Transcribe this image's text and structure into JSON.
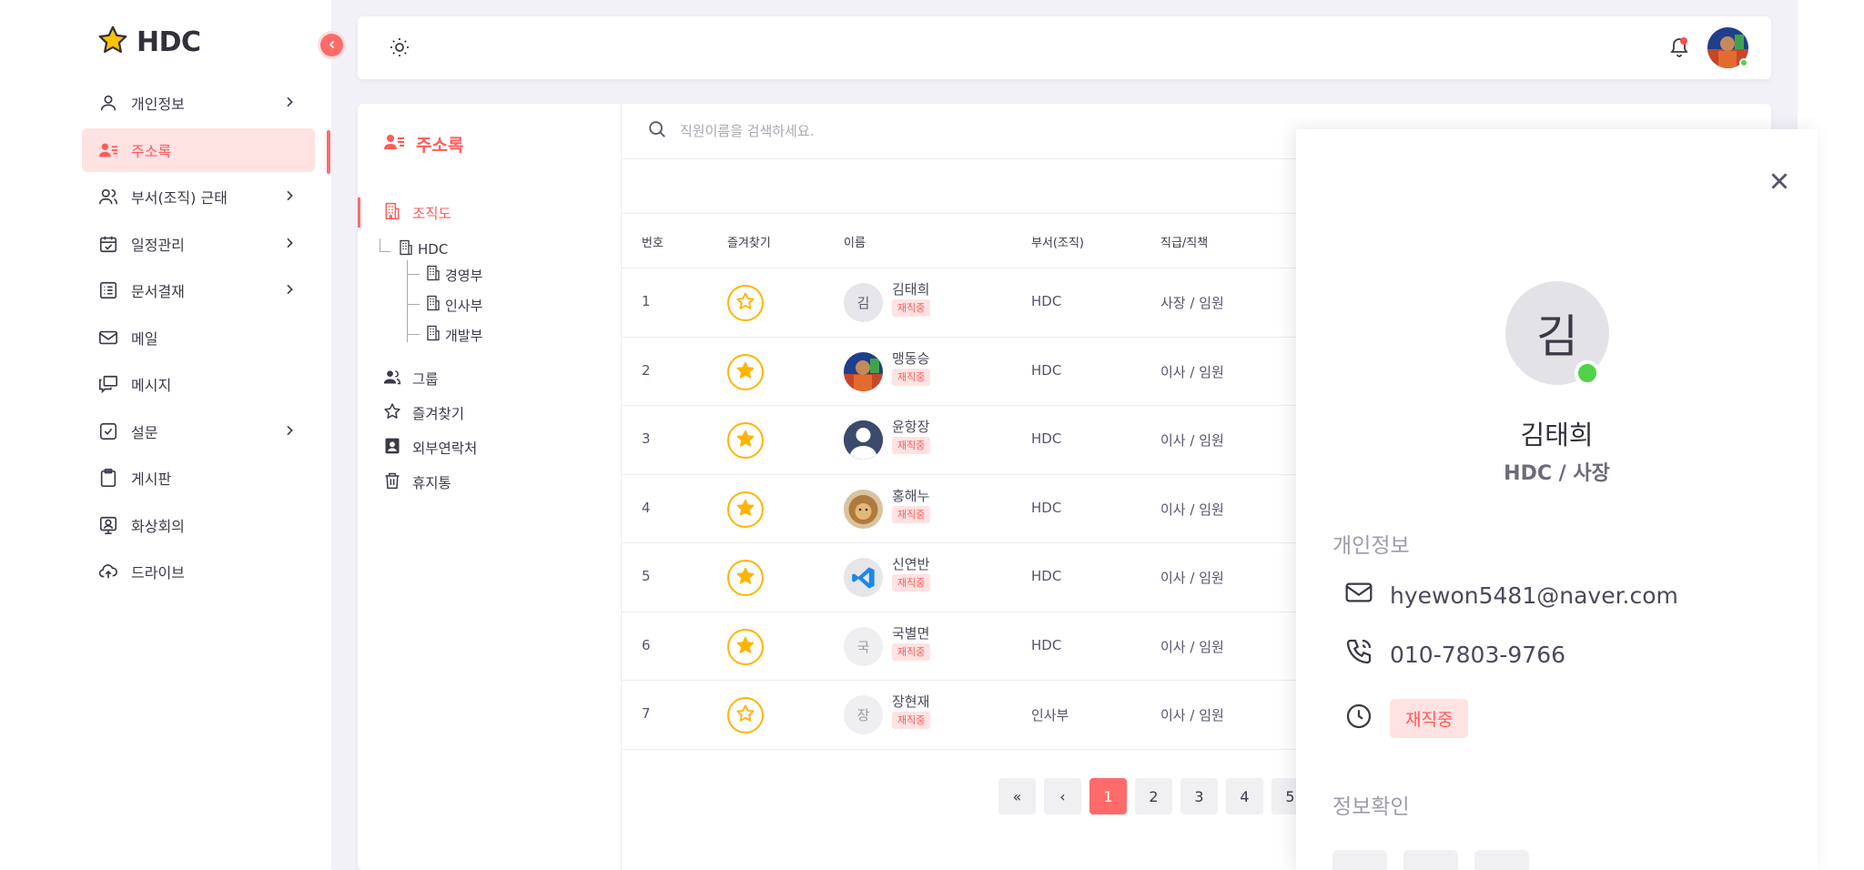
{
  "app": {
    "logo_text": "HDC",
    "accent": "#ff6b6b"
  },
  "sidebar": {
    "items": [
      {
        "label": "개인정보",
        "icon": "user-icon",
        "has_chevron": true
      },
      {
        "label": "주소록",
        "icon": "contacts-icon",
        "active": true
      },
      {
        "label": "부서(조직) 근태",
        "icon": "users-icon",
        "has_chevron": true
      },
      {
        "label": "일정관리",
        "icon": "calendar-check-icon",
        "has_chevron": true
      },
      {
        "label": "문서결재",
        "icon": "document-list-icon",
        "has_chevron": true
      },
      {
        "label": "메일",
        "icon": "mail-icon"
      },
      {
        "label": "메시지",
        "icon": "message-icon"
      },
      {
        "label": "설문",
        "icon": "survey-check-icon",
        "has_chevron": true
      },
      {
        "label": "게시판",
        "icon": "clipboard-icon"
      },
      {
        "label": "화상회의",
        "icon": "video-conference-icon"
      },
      {
        "label": "드라이브",
        "icon": "cloud-upload-icon"
      }
    ]
  },
  "address_panel": {
    "title": "주소록",
    "org_chart": "조직도",
    "tree": {
      "root": "HDC",
      "children": [
        "경영부",
        "인사부",
        "개발부"
      ]
    },
    "group": "그룹",
    "favorites": "즐겨찾기",
    "external": "외부연락처",
    "trash": "휴지통"
  },
  "search": {
    "placeholder": "직원이름을 검색하세요.",
    "value": ""
  },
  "table": {
    "headers": [
      "번호",
      "즐겨찾기",
      "이름",
      "부서(조직)",
      "직급/직책"
    ],
    "rows": [
      {
        "no": "1",
        "favorite": false,
        "avatar": "김",
        "avatar_type": "initial",
        "name": "김태희",
        "status": "재직중",
        "dept": "HDC",
        "rank": "사장 / 임원"
      },
      {
        "no": "2",
        "favorite": true,
        "avatar": "",
        "avatar_type": "photo-person",
        "name": "맹동승",
        "status": "재직중",
        "dept": "HDC",
        "rank": "이사 / 임원"
      },
      {
        "no": "3",
        "favorite": true,
        "avatar": "",
        "avatar_type": "default-silhouette",
        "name": "윤항장",
        "status": "재직중",
        "dept": "HDC",
        "rank": "이사 / 임원"
      },
      {
        "no": "4",
        "favorite": true,
        "avatar": "",
        "avatar_type": "photo-lion",
        "name": "홍해누",
        "status": "재직중",
        "dept": "HDC",
        "rank": "이사 / 임원"
      },
      {
        "no": "5",
        "favorite": true,
        "avatar": "",
        "avatar_type": "vscode-logo",
        "name": "신연반",
        "status": "재직중",
        "dept": "HDC",
        "rank": "이사 / 임원"
      },
      {
        "no": "6",
        "favorite": true,
        "avatar": "국",
        "avatar_type": "initial",
        "name": "국별면",
        "status": "재직중",
        "dept": "HDC",
        "rank": "이사 / 임원"
      },
      {
        "no": "7",
        "favorite": false,
        "avatar": "장",
        "avatar_type": "initial",
        "name": "장현재",
        "status": "재직중",
        "dept": "인사부",
        "rank": "이사 / 임원"
      }
    ]
  },
  "pagination": {
    "first": "«",
    "prev": "‹",
    "pages": [
      "1",
      "2",
      "3",
      "4",
      "5"
    ],
    "current": "1"
  },
  "detail": {
    "avatar": "김",
    "name": "김태희",
    "sub": "HDC / 사장",
    "section_personal": "개인정보",
    "email": "hyewon5481@naver.com",
    "phone": "010-7803-9766",
    "status": "재직중",
    "section_confirm": "정보확인"
  }
}
